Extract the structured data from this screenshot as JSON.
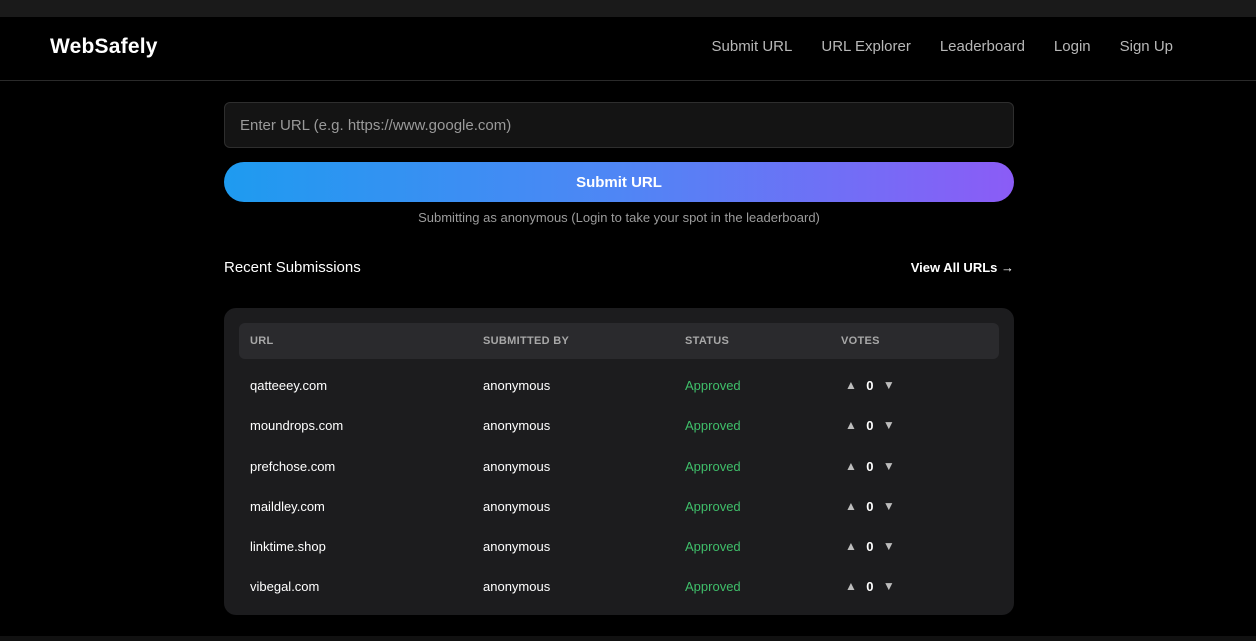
{
  "brand": "WebSafely",
  "nav": [
    "Submit URL",
    "URL Explorer",
    "Leaderboard",
    "Login",
    "Sign Up"
  ],
  "form": {
    "placeholder": "Enter URL (e.g. https://www.google.com)",
    "submit_label": "Submit URL",
    "note": "Submitting as anonymous (Login to take your spot in the leaderboard)"
  },
  "recent": {
    "title": "Recent Submissions",
    "view_all": "View All URLs →",
    "columns": [
      "URL",
      "SUBMITTED BY",
      "STATUS",
      "VOTES"
    ],
    "rows": [
      {
        "url": "qatteeey.com",
        "by": "anonymous",
        "status": "Approved",
        "votes": "0"
      },
      {
        "url": "moundrops.com",
        "by": "anonymous",
        "status": "Approved",
        "votes": "0"
      },
      {
        "url": "prefchose.com",
        "by": "anonymous",
        "status": "Approved",
        "votes": "0"
      },
      {
        "url": "maildley.com",
        "by": "anonymous",
        "status": "Approved",
        "votes": "0"
      },
      {
        "url": "linktime.shop",
        "by": "anonymous",
        "status": "Approved",
        "votes": "0"
      },
      {
        "url": "vibegal.com",
        "by": "anonymous",
        "status": "Approved",
        "votes": "0"
      }
    ]
  },
  "icons": {
    "upvote": "▲",
    "downvote": "▼"
  },
  "colors": {
    "approved": "#3fbf6a",
    "gradient_start": "#1e9bf0",
    "gradient_end": "#8b5cf6"
  }
}
